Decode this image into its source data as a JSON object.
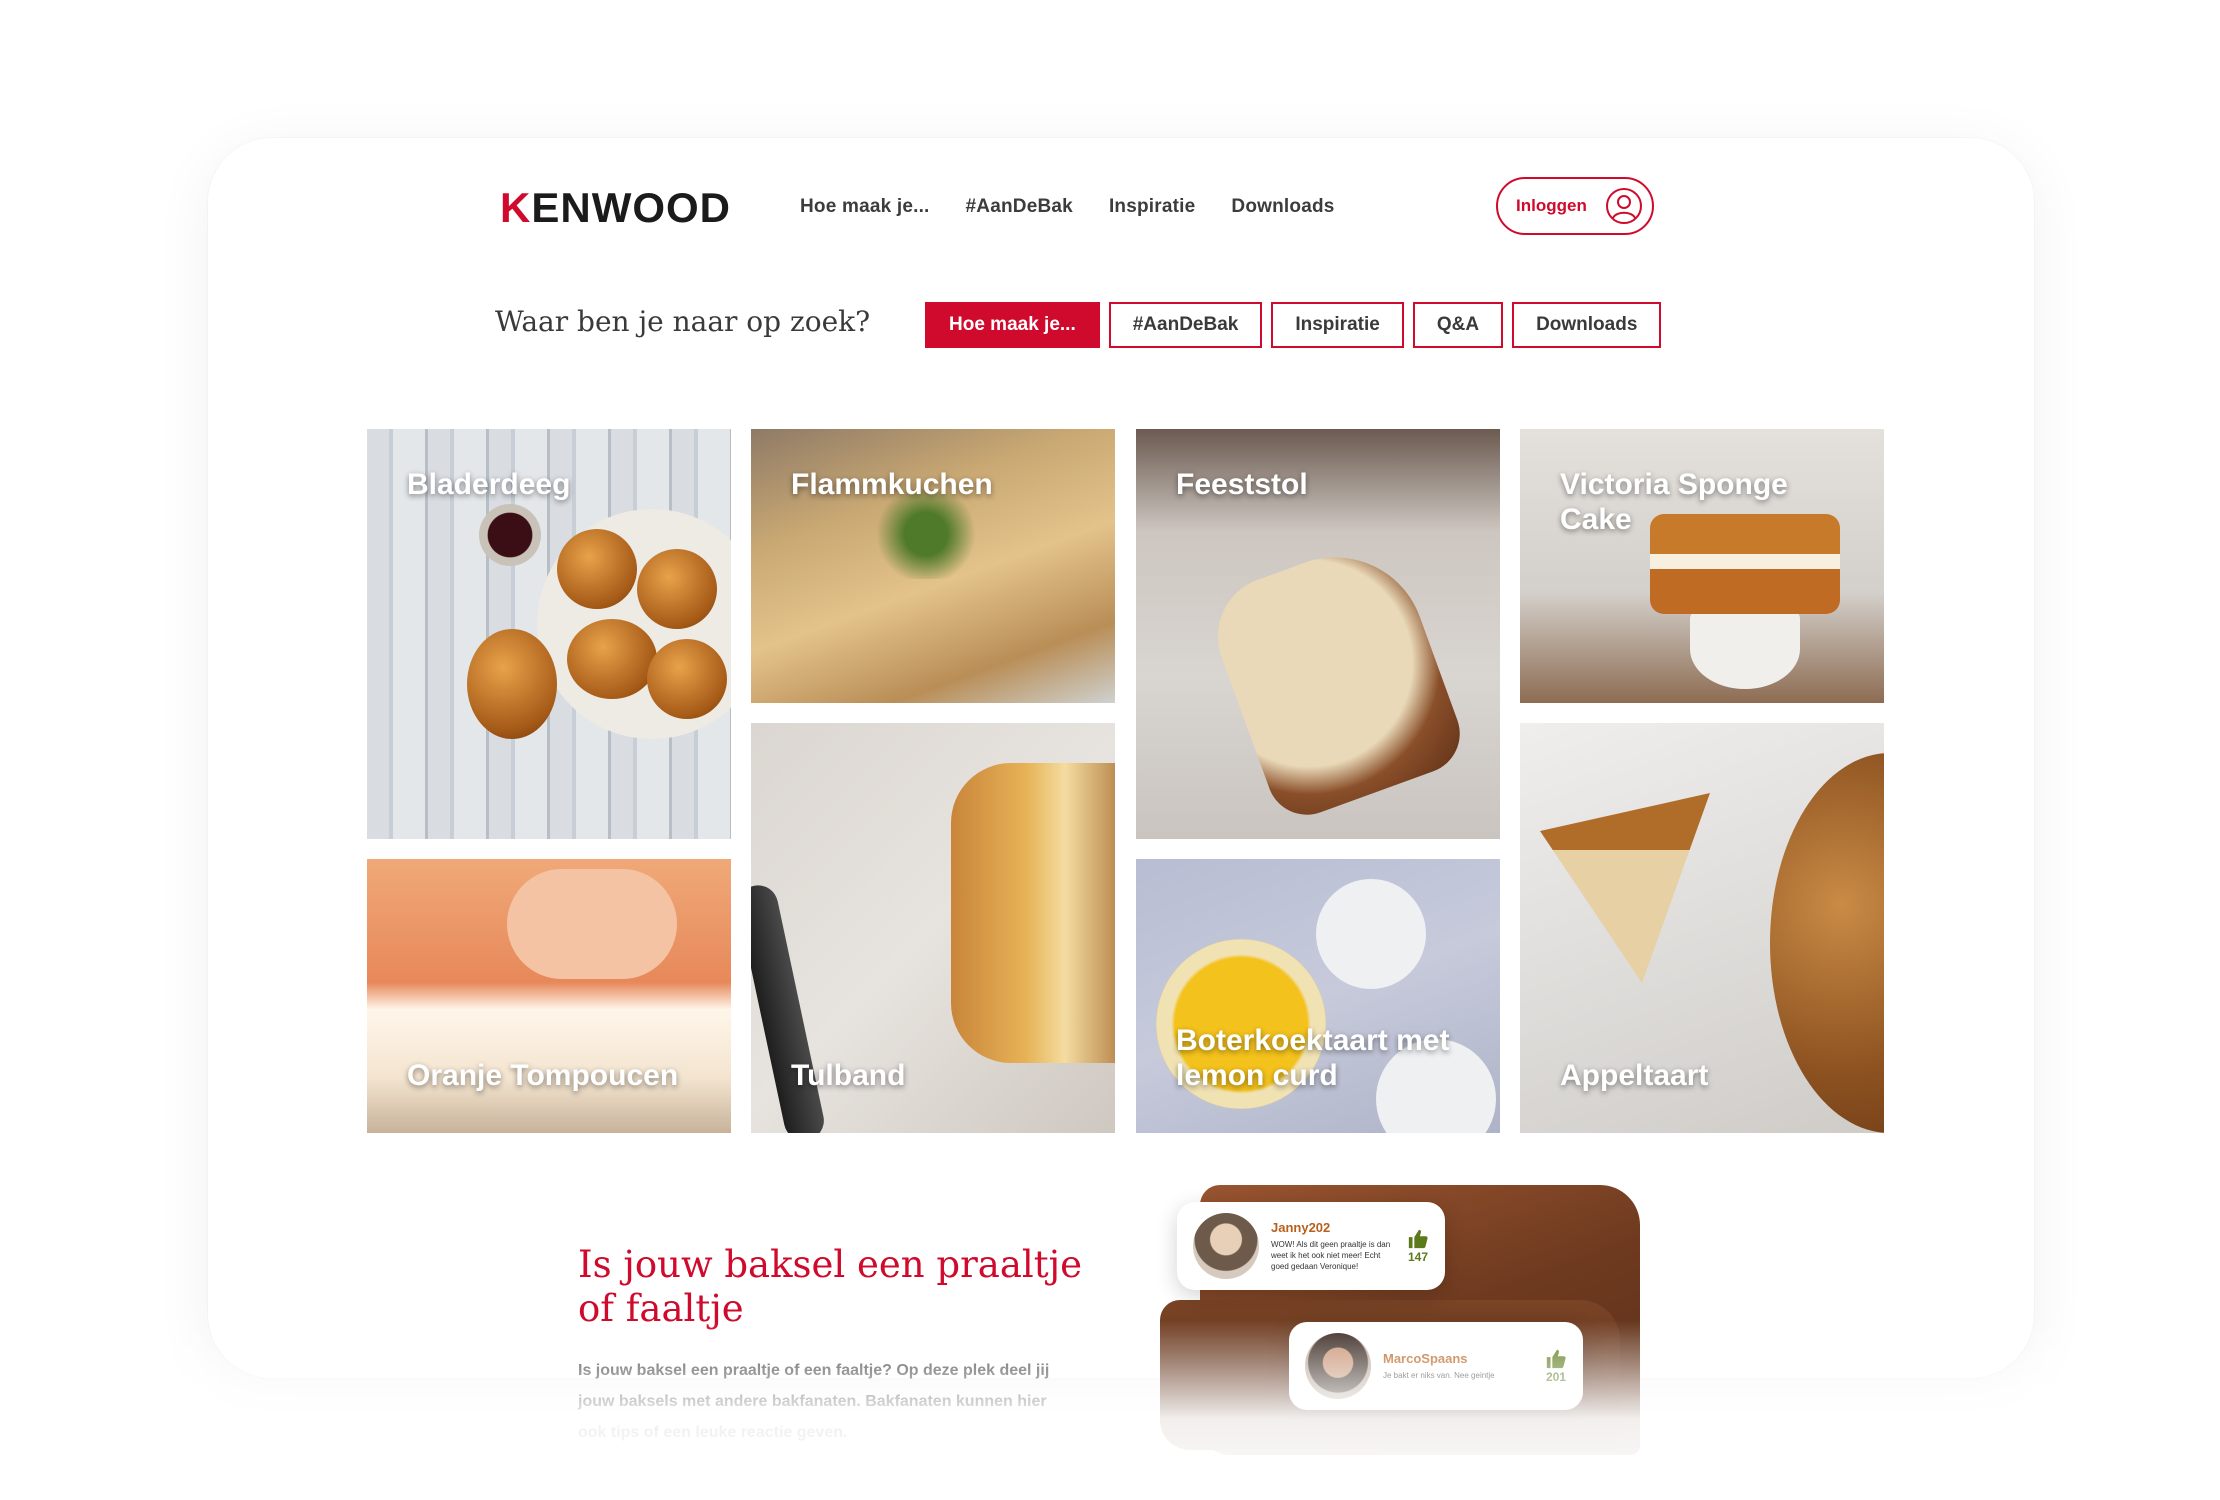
{
  "header": {
    "logo_prefix": "K",
    "logo_rest": "ENWOOD",
    "nav": [
      "Hoe maak je...",
      "#AanDeBak",
      "Inspiratie",
      "Downloads"
    ],
    "login_label": "Inloggen"
  },
  "filter": {
    "question": "Waar ben je naar op zoek?",
    "chips": [
      "Hoe maak je...",
      "#AanDeBak",
      "Inspiratie",
      "Q&A",
      "Downloads"
    ],
    "active_index": 0
  },
  "tiles": [
    "Bladerdeeg",
    "Flammkuchen",
    "Feeststol",
    "Victoria Sponge Cake",
    "Oranje Tompoucen",
    "Tulband",
    "Boterkoektaart met lemon curd",
    "Appeltaart"
  ],
  "section": {
    "headline": "Is jouw baksel een praaltje of faaltje",
    "body": "Is jouw baksel een praaltje of een faaltje? Op deze plek deel jij jouw baksels met andere bakfanaten. Bakfanaten kunnen hier ook tips of een leuke reactie geven."
  },
  "comments": [
    {
      "user": "Janny202",
      "text": "WOW! Als dit geen praaltje is dan weet ik het ook niet meer! Echt goed gedaan Veronique!",
      "likes": "147"
    },
    {
      "user": "MarcoSpaans",
      "text": "Je bakt er niks van. Nee geintje",
      "likes": "201"
    }
  ],
  "colors": {
    "brand_red": "#cf0a2c",
    "like_green": "#5b7a1a",
    "username_orange": "#b8601c"
  }
}
